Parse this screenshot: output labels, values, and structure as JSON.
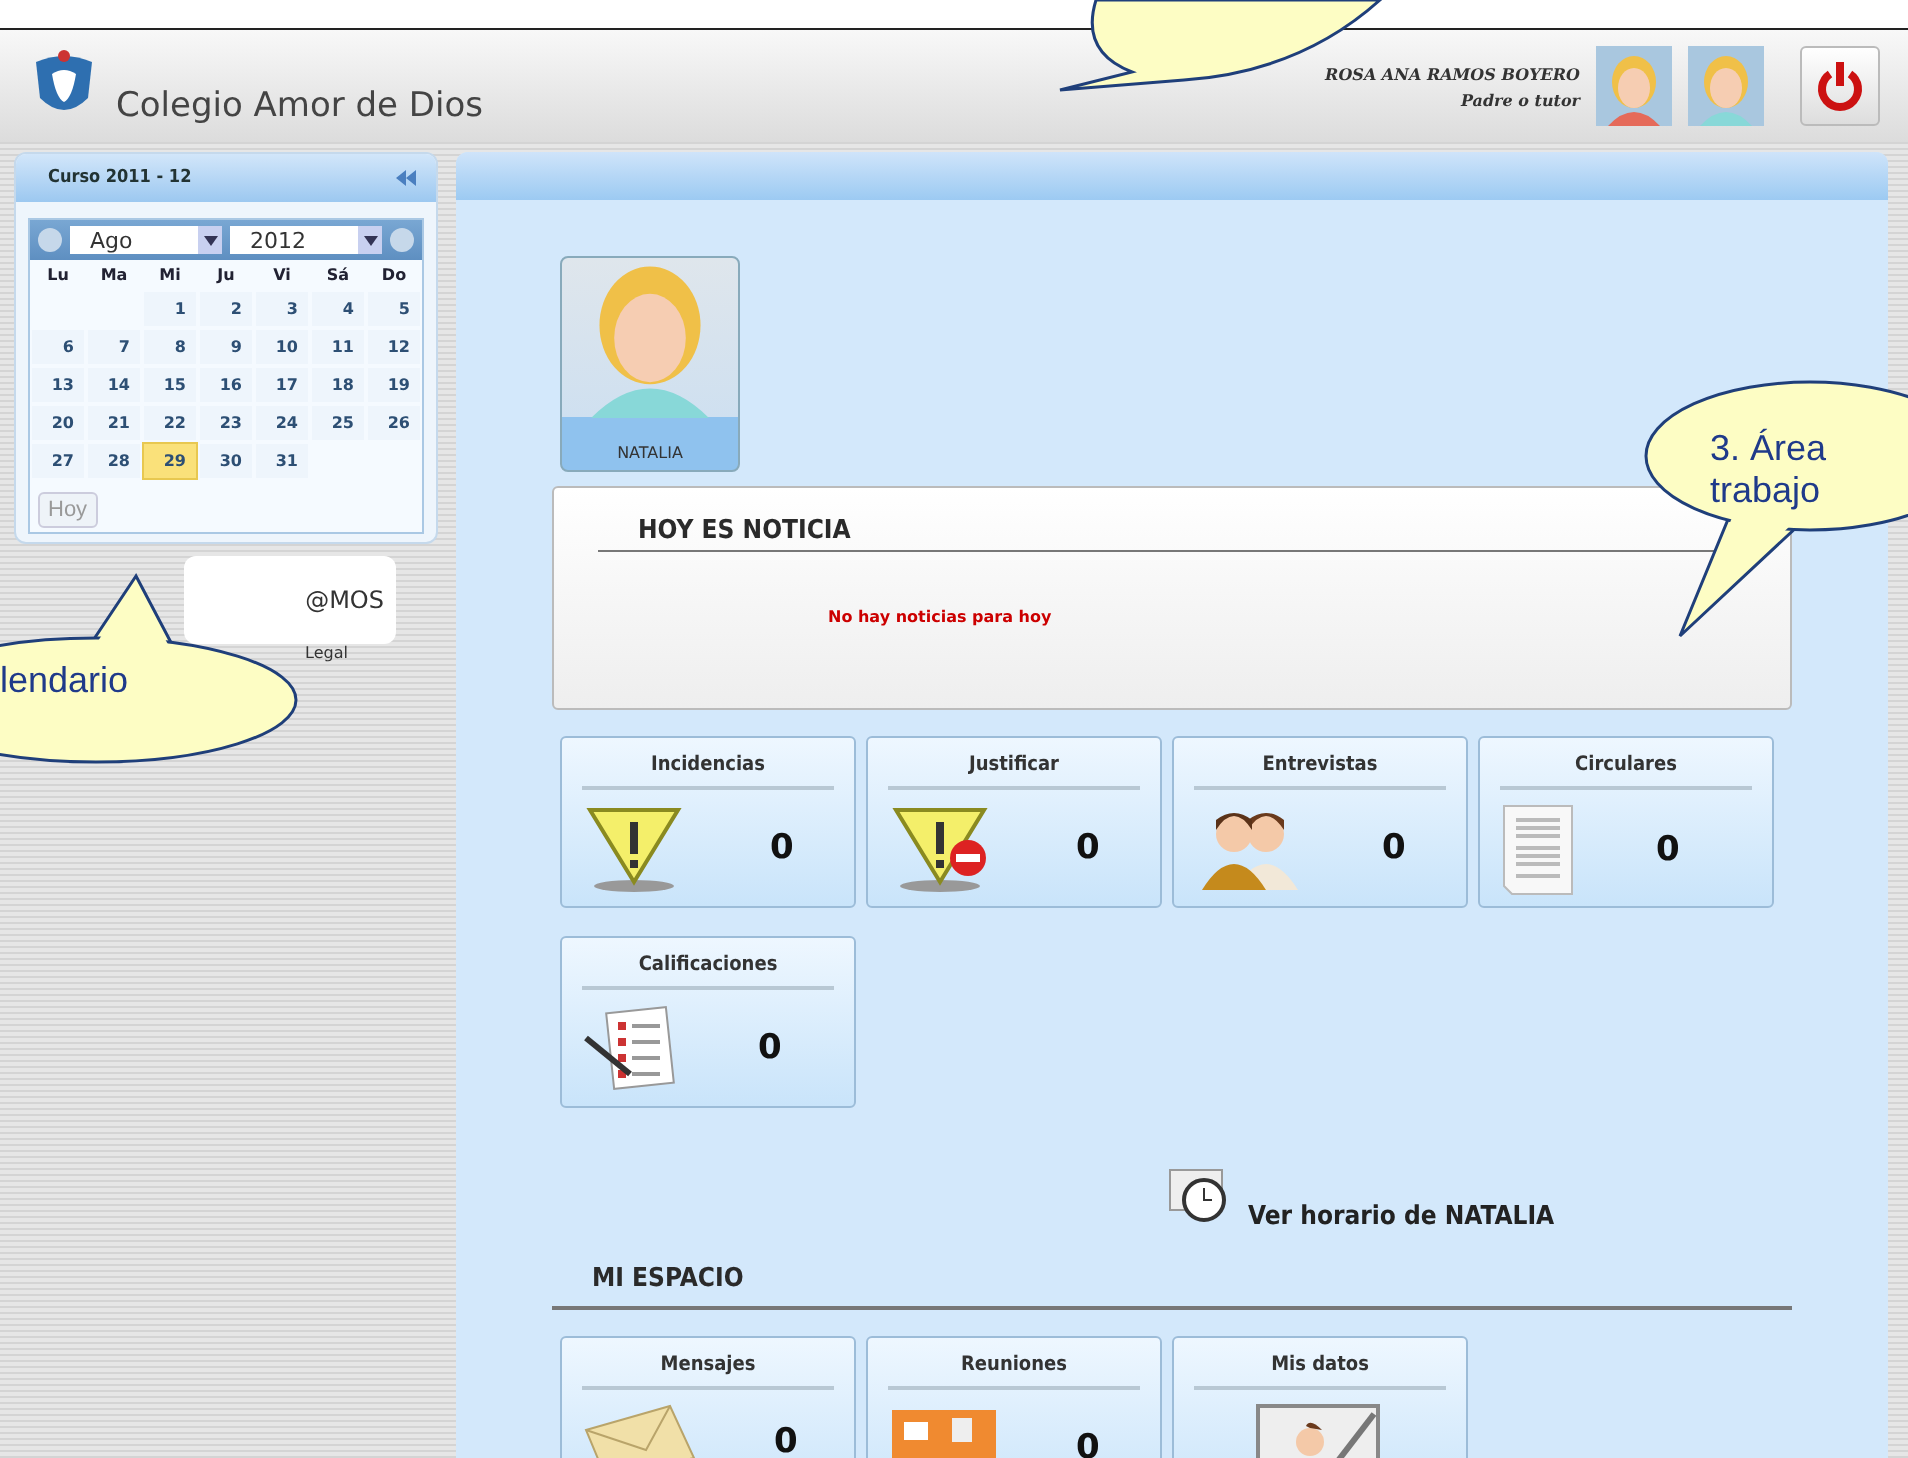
{
  "header": {
    "school_name": "Colegio Amor de Dios",
    "user_name": "ROSA ANA RAMOS BOYERO",
    "user_role": "Padre o tutor"
  },
  "sidebar": {
    "course": "Curso 2011 - 12",
    "calendar": {
      "month": "Ago",
      "year": "2012",
      "weekdays": [
        "Lu",
        "Ma",
        "Mi",
        "Ju",
        "Vi",
        "Sá",
        "Do"
      ],
      "weeks": [
        [
          {
            "day": "1",
            "selected": false
          },
          {
            "day": "2",
            "selected": false
          },
          {
            "day": "3",
            "selected": false
          },
          {
            "day": "4",
            "selected": false
          },
          {
            "day": "5",
            "selected": false
          }
        ],
        [
          {
            "day": "6",
            "selected": false
          },
          {
            "day": "7",
            "selected": false
          },
          {
            "day": "8",
            "selected": false
          },
          {
            "day": "9",
            "selected": false
          },
          {
            "day": "10",
            "selected": false
          },
          {
            "day": "11",
            "selected": false
          },
          {
            "day": "12",
            "selected": false
          }
        ],
        [
          {
            "day": "13",
            "selected": false
          },
          {
            "day": "14",
            "selected": false
          },
          {
            "day": "15",
            "selected": false
          },
          {
            "day": "16",
            "selected": false
          },
          {
            "day": "17",
            "selected": false
          },
          {
            "day": "18",
            "selected": false
          },
          {
            "day": "19",
            "selected": false
          }
        ],
        [
          {
            "day": "20",
            "selected": false
          },
          {
            "day": "21",
            "selected": false
          },
          {
            "day": "22",
            "selected": false
          },
          {
            "day": "23",
            "selected": false
          },
          {
            "day": "24",
            "selected": false
          },
          {
            "day": "25",
            "selected": false
          },
          {
            "day": "26",
            "selected": false
          }
        ],
        [
          {
            "day": "27",
            "selected": false
          },
          {
            "day": "28",
            "selected": false
          },
          {
            "day": "29",
            "selected": true
          },
          {
            "day": "30",
            "selected": false
          },
          {
            "day": "31",
            "selected": false
          }
        ]
      ],
      "today_button": "Hoy"
    },
    "logo_text": "@MOS",
    "legal_link": "Legal"
  },
  "main": {
    "student": {
      "name": "NATALIA"
    },
    "news": {
      "title": "HOY ES NOTICIA",
      "message": "No hay noticias para hoy"
    },
    "tiles": [
      {
        "kind": "warning",
        "label": "Incidencias",
        "count": "0"
      },
      {
        "kind": "justify",
        "label": "Justificar",
        "count": "0"
      },
      {
        "kind": "people",
        "label": "Entrevistas",
        "count": "0"
      },
      {
        "kind": "document",
        "label": "Circulares",
        "count": "0"
      },
      {
        "kind": "checklist",
        "label": "Calificaciones",
        "count": "0"
      }
    ],
    "schedule_link": "Ver horario de NATALIA",
    "my_space": {
      "title": "MI ESPACIO",
      "tiles": [
        {
          "kind": "envelope",
          "label": "Mensajes",
          "count": "0"
        },
        {
          "kind": "meeting",
          "label": "Reuniones",
          "count": "0"
        },
        {
          "kind": "profile",
          "label": "Mis datos"
        }
      ]
    }
  },
  "callouts": [
    {
      "kind": "top"
    },
    {
      "kind": "left",
      "text": "lendario"
    },
    {
      "kind": "right",
      "text": "3. Área trabajo"
    }
  ]
}
